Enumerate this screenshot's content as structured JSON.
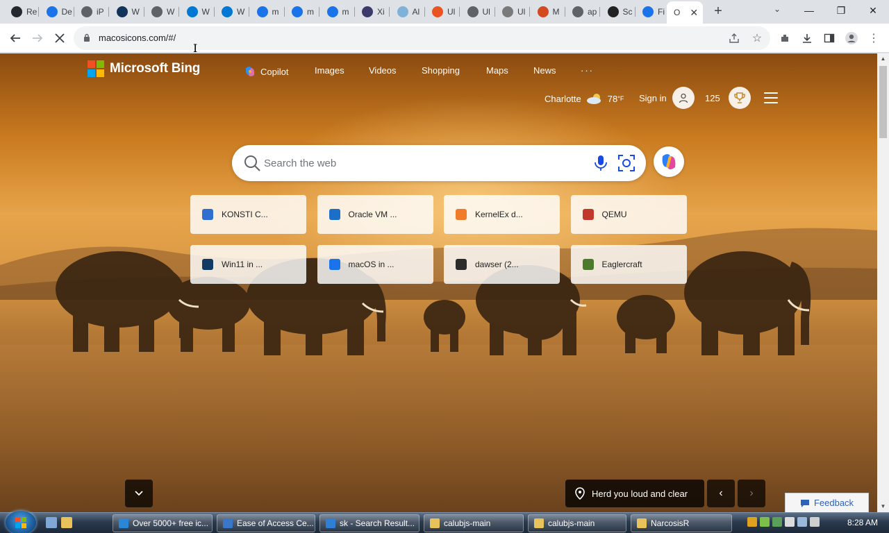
{
  "browser": {
    "tabs": [
      {
        "label": "Re",
        "color": "#24292f"
      },
      {
        "label": "De",
        "color": "#1a73e8"
      },
      {
        "label": "iP",
        "color": "#5f6368"
      },
      {
        "label": "W",
        "color": "#10345a"
      },
      {
        "label": "W",
        "color": "#5f6368"
      },
      {
        "label": "W",
        "color": "#0078d4"
      },
      {
        "label": "W",
        "color": "#0078d4"
      },
      {
        "label": "m",
        "color": "#1a73e8"
      },
      {
        "label": "m",
        "color": "#1a73e8"
      },
      {
        "label": "m",
        "color": "#1a73e8"
      },
      {
        "label": "Xi",
        "color": "#3b3b6b"
      },
      {
        "label": "Al",
        "color": "#7fb2d8"
      },
      {
        "label": "Ul",
        "color": "#e95420"
      },
      {
        "label": "Ul",
        "color": "#5f6368"
      },
      {
        "label": "Ul",
        "color": "#7a7a7a"
      },
      {
        "label": "M",
        "color": "#d44a1f"
      },
      {
        "label": "ap",
        "color": "#5f6368"
      },
      {
        "label": "Sc",
        "color": "#222222"
      },
      {
        "label": "Fi",
        "color": "#1a73e8"
      }
    ],
    "active_tab": {
      "label": "O"
    },
    "url": "macosicons.com/#/"
  },
  "bing": {
    "logo_text": "Microsoft Bing",
    "nav": {
      "copilot": "Copilot",
      "images": "Images",
      "videos": "Videos",
      "shopping": "Shopping",
      "maps": "Maps",
      "news": "News",
      "more": "···"
    },
    "location": "Charlotte",
    "temperature": "78",
    "temp_unit": "°F",
    "sign_in": "Sign in",
    "points": "125",
    "search_placeholder": "Search the web",
    "tiles": [
      {
        "label": "KONSTI C...",
        "color": "#2f6fd1"
      },
      {
        "label": "Oracle VM ...",
        "color": "#1c6fc7"
      },
      {
        "label": "KernelEx d...",
        "color": "#f07c2a"
      },
      {
        "label": "QEMU",
        "color": "#c0392b"
      },
      {
        "label": "Win11 in ...",
        "color": "#123a63"
      },
      {
        "label": "macOS in ...",
        "color": "#1a73e8"
      },
      {
        "label": "dawser (2...",
        "color": "#2b2b2b"
      },
      {
        "label": "Eaglercraft",
        "color": "#4c7a2c"
      }
    ],
    "caption": "Herd you loud and clear",
    "feedback": "Feedback"
  },
  "taskbar": {
    "items": [
      {
        "label": "Over 5000+ free ic...",
        "color": "#2c86d6"
      },
      {
        "label": "Ease of Access Ce...",
        "color": "#3a77c8"
      },
      {
        "label": "sk - Search Result...",
        "color": "#2f7fd4"
      },
      {
        "label": "calubjs-main",
        "color": "#e8c25a"
      },
      {
        "label": "calubjs-main",
        "color": "#e8c25a"
      },
      {
        "label": "NarcosisR",
        "color": "#e8c25a"
      }
    ],
    "clock": "8:28 AM"
  }
}
